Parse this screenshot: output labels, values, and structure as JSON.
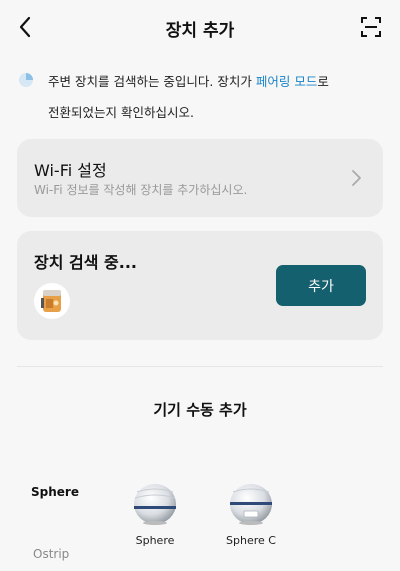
{
  "header": {
    "title": "장치 추가"
  },
  "notice": {
    "line1_prefix": "주변 장치를 검색하는 중입니다. 장치가 ",
    "line1_link": "페어링 모드",
    "line1_suffix": "로",
    "line2": "전환되었는지 확인하십시오."
  },
  "wifi": {
    "title": "Wi-Fi 설정",
    "subtitle": "Wi-Fi 정보를 작성해 장치를 추가하십시오."
  },
  "search": {
    "title": "장치 검색 중...",
    "add_label": "추가"
  },
  "manual": {
    "title": "기기 수동 추가",
    "categories": [
      "Sphere",
      "Ostrip"
    ],
    "devices": [
      {
        "name": "Sphere"
      },
      {
        "name": "Sphere C"
      }
    ]
  },
  "colors": {
    "accent": "#15606e",
    "link": "#1a84c8",
    "card_bg": "#ebebeb",
    "page_bg": "#f7f7f7"
  }
}
